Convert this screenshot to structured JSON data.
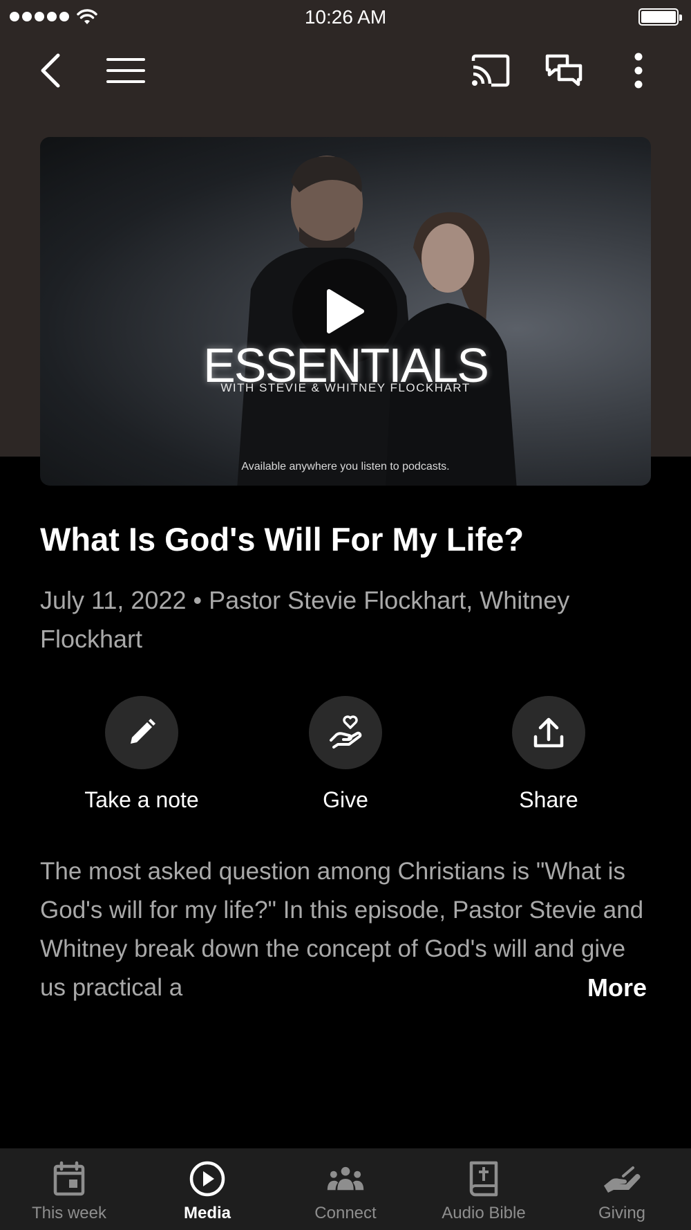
{
  "status_bar": {
    "time": "10:26 AM"
  },
  "nav": {
    "icons": [
      "back-icon",
      "menu-icon",
      "cast-icon",
      "chat-icon",
      "more-vertical-icon"
    ]
  },
  "media": {
    "poster_title": "ESSENTIALS",
    "poster_subtitle": "WITH STEVIE & WHITNEY FLOCKHART",
    "poster_caption": "Available anywhere you listen to podcasts.",
    "play_icon": "play-icon"
  },
  "episode": {
    "title": "What Is God's Will For My Life?",
    "meta": "July 11, 2022 • Pastor Stevie Flockhart, Whitney Flockhart"
  },
  "actions": [
    {
      "label": "Take a note",
      "icon": "pencil-icon"
    },
    {
      "label": "Give",
      "icon": "give-heart-hand-icon"
    },
    {
      "label": "Share",
      "icon": "share-upload-icon"
    }
  ],
  "description": {
    "text": "The most asked question among Christians is \"What is God's will for my life?\" In this episode, Pastor Stevie and Whitney break down the concept of God's will and give us practical a",
    "more_label": "More"
  },
  "tabs": [
    {
      "label": "This week",
      "icon": "calendar-icon",
      "active": false
    },
    {
      "label": "Media",
      "icon": "play-circle-icon",
      "active": true
    },
    {
      "label": "Connect",
      "icon": "people-icon",
      "active": false
    },
    {
      "label": "Audio Bible",
      "icon": "bible-icon",
      "active": false
    },
    {
      "label": "Giving",
      "icon": "giving-hand-icon",
      "active": false
    }
  ],
  "colors": {
    "header_background": "#2d2725",
    "page_background": "#000000",
    "secondary_text": "#a9a9a9",
    "tab_bar_background": "#1e1e1e",
    "inactive_tab": "#8e8e8e"
  }
}
